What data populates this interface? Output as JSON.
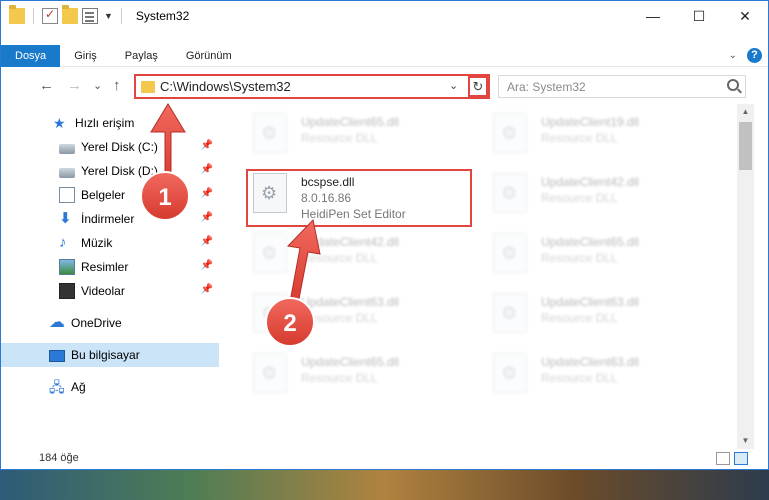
{
  "window": {
    "title": "System32",
    "controls": {
      "minimize": "—",
      "maximize": "☐",
      "close": "✕"
    }
  },
  "ribbon": {
    "tabs": [
      "Dosya",
      "Giriş",
      "Paylaş",
      "Görünüm"
    ],
    "help": "?"
  },
  "nav": {
    "back": "←",
    "forward": "→",
    "recent": "⌄",
    "up": "↑",
    "address": "C:\\Windows\\System32",
    "refresh": "↻",
    "search_placeholder": "Ara: System32"
  },
  "sidebar": {
    "quick_access": "Hızlı erişim",
    "items": [
      {
        "label": "Yerel Disk (C:)",
        "icon": "drive-icon"
      },
      {
        "label": "Yerel Disk (D:)",
        "icon": "drive-icon"
      },
      {
        "label": "Belgeler",
        "icon": "documents-icon"
      },
      {
        "label": "İndirmeler",
        "icon": "downloads-icon"
      },
      {
        "label": "Müzik",
        "icon": "music-icon"
      },
      {
        "label": "Resimler",
        "icon": "pictures-icon"
      },
      {
        "label": "Videolar",
        "icon": "videos-icon"
      }
    ],
    "onedrive": "OneDrive",
    "this_pc": "Bu bilgisayar",
    "network": "Ağ"
  },
  "files": {
    "left": [
      {
        "name": "UpdateClient65.dll",
        "desc": "Resource DLL"
      },
      {
        "name": "bcspse.dll",
        "desc": "8.0.16.86",
        "sub": "HeidiPen Set Editor"
      },
      {
        "name": "UpdateClient42.dll",
        "desc": "Resource DLL"
      },
      {
        "name": "UpdateClient63.dll",
        "desc": "Resource DLL"
      },
      {
        "name": "UpdateClient65.dll",
        "desc": "Resource DLL"
      }
    ],
    "right": [
      {
        "name": "UpdateClient19.dll",
        "desc": "Resource DLL"
      },
      {
        "name": "UpdateClient42.dll",
        "desc": "Resource DLL"
      },
      {
        "name": "UpdateClient65.dll",
        "desc": "Resource DLL"
      },
      {
        "name": "UpdateClient63.dll",
        "desc": "Resource DLL"
      },
      {
        "name": "UpdateClient63.dll",
        "desc": "Resource DLL"
      }
    ]
  },
  "status": {
    "count": "184 öğe"
  },
  "annotations": {
    "step1": "1",
    "step2": "2"
  },
  "colors": {
    "accent": "#1979ca",
    "highlight": "#e0453f",
    "selected": "#cce4f7"
  }
}
